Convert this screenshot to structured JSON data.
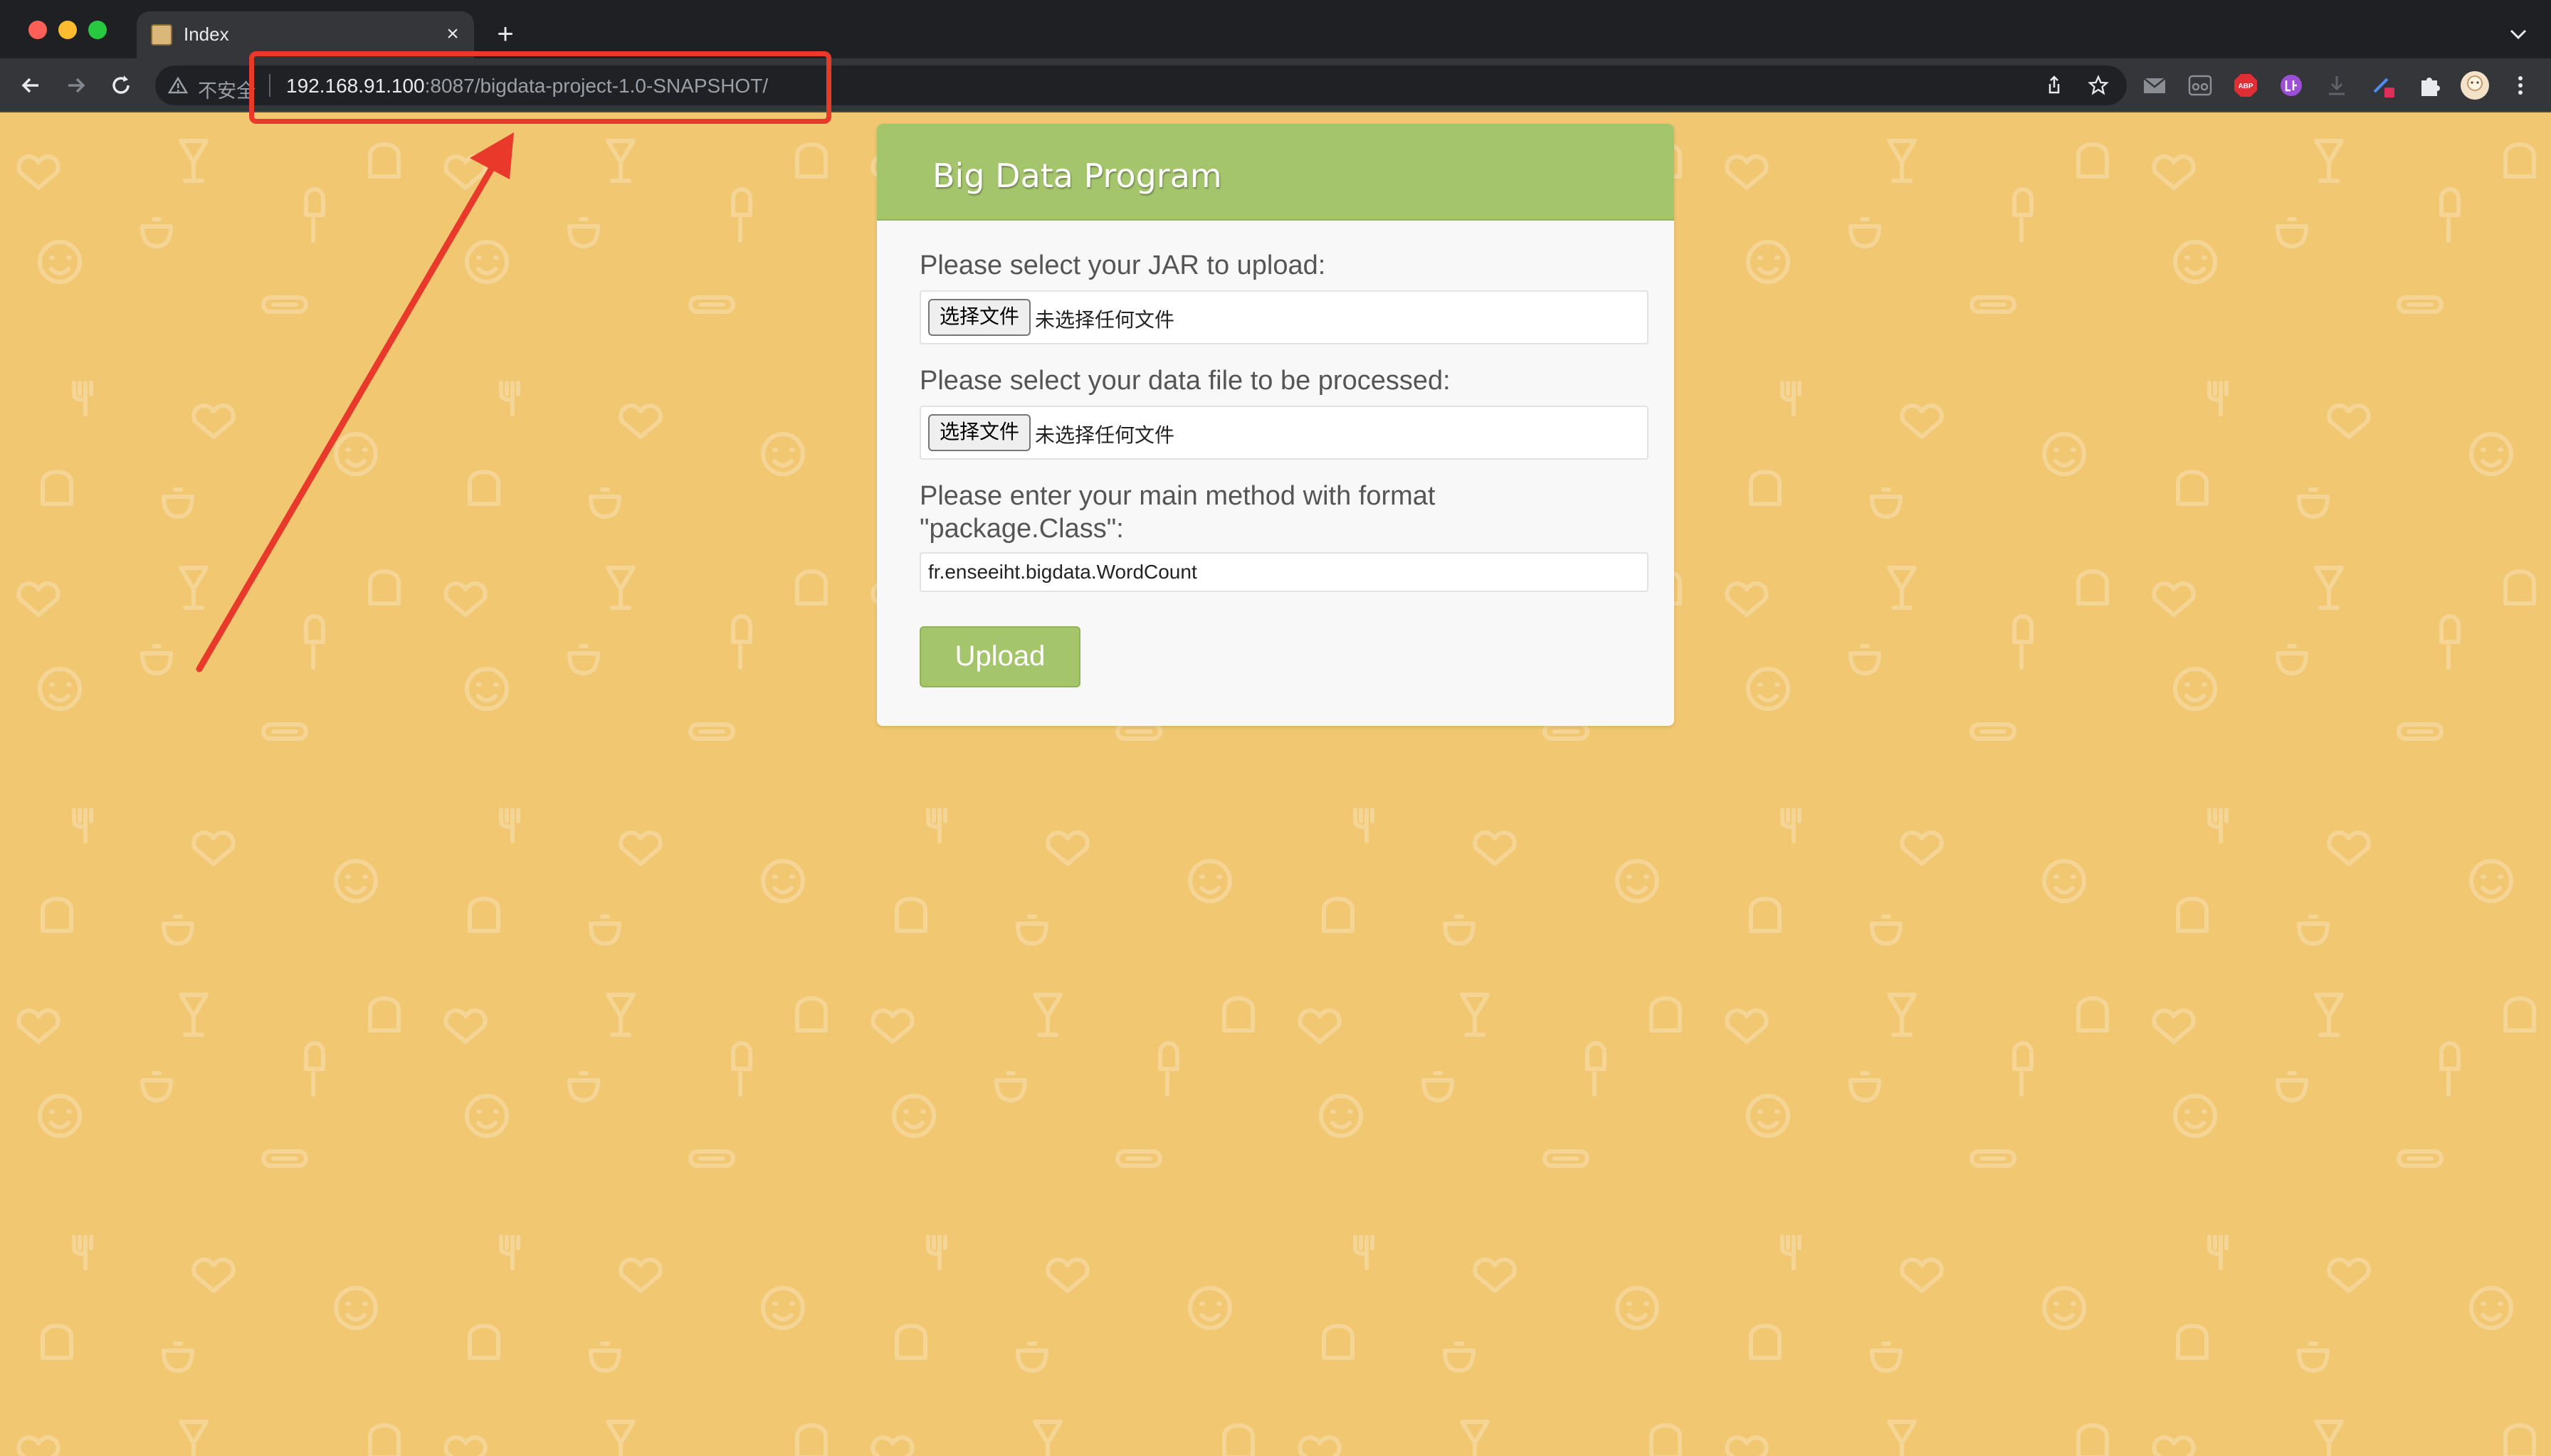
{
  "browser": {
    "tab_title": "Index",
    "tab_close": "×",
    "new_tab": "+",
    "security_label": "不安全",
    "url_host": "192.168.91.100",
    "url_rest": ":8087/bigdata-project-1.0-SNAPSHOT/",
    "extensions": [
      "mail-icon",
      "reader-icon",
      "adblock-icon",
      "translate-icon",
      "download-icon",
      "pen-icon",
      "puzzle-icon",
      "avatar"
    ],
    "adblock_label": "ABP"
  },
  "form": {
    "title": "Big Data Program",
    "jar_label": "Please select your JAR to upload:",
    "data_label": "Please select your data file to be processed:",
    "method_label_line1": "Please enter your main method with format",
    "method_label_line2": "\"package.Class\":",
    "choose_file_button": "选择文件",
    "no_file_chosen": "未选择任何文件",
    "main_class_value": "fr.enseeiht.bigdata.WordCount",
    "upload_button": "Upload"
  },
  "colors": {
    "page_bg": "#f2c772",
    "header_green": "#a5c56d",
    "annotation_red": "#e8392b"
  }
}
